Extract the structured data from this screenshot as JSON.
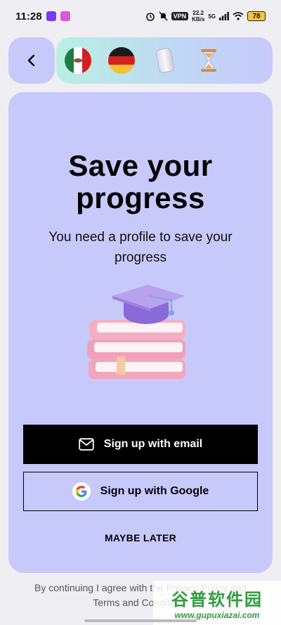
{
  "status_bar": {
    "time": "11:28",
    "network_speed_value": "22.2",
    "network_speed_unit": "KB/s",
    "vpn_label": "VPN",
    "signal_label": "5G",
    "battery": "78"
  },
  "top_bar": {
    "items": [
      {
        "name": "mexico-flag",
        "colors": [
          "#1e7d43",
          "#ffffff",
          "#d21f26"
        ]
      },
      {
        "name": "germany-flag",
        "colors": [
          "#1a1a1a",
          "#d4201f",
          "#f2c12e"
        ]
      },
      {
        "name": "can"
      },
      {
        "name": "hourglass"
      }
    ]
  },
  "card": {
    "title_line1": "Save your",
    "title_line2": "progress",
    "subtitle": "You need a profile to save your progress",
    "email_button": "Sign up with email",
    "google_button": "Sign up with Google",
    "maybe_later": "MAYBE LATER"
  },
  "footer": {
    "line1": "By continuing I agree with the Privacy Policy and",
    "line2": "Terms and Conditions"
  },
  "watermark": {
    "title": "谷普软件园",
    "url": "www.gupuxiazai.com"
  },
  "colors": {
    "background": "#efeff3",
    "card": "#c7c9fb",
    "primary_button": "#000000"
  }
}
